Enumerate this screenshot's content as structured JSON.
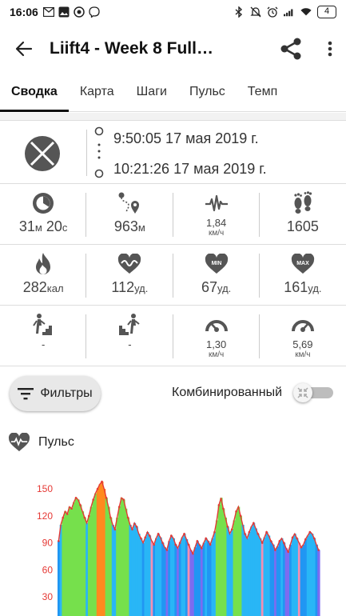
{
  "status_bar": {
    "time": "16:06",
    "battery": "4",
    "left_icons": [
      "mail-icon",
      "photo-icon",
      "camera-icon",
      "viber-icon"
    ],
    "right_icons": [
      "bluetooth-icon",
      "mute-icon",
      "alarm-icon",
      "signal-icon",
      "wifi-icon"
    ]
  },
  "app_bar": {
    "title": "Liift4 - Week 8 Full…",
    "back_icon": "arrow-back-icon",
    "share_icon": "share-icon",
    "more_icon": "more-vert-icon"
  },
  "tabs": [
    {
      "label": "Сводка",
      "active": true
    },
    {
      "label": "Карта",
      "active": false
    },
    {
      "label": "Шаги",
      "active": false
    },
    {
      "label": "Пульс",
      "active": false
    },
    {
      "label": "Темп",
      "active": false
    }
  ],
  "workout": {
    "start_time": "9:50:05 17 мая 2019 г.",
    "end_time": "10:21:26 17 мая 2019 г."
  },
  "stats": [
    [
      {
        "icon": "duration-icon",
        "value": "31",
        "unit1": "м",
        "value2": " 20",
        "unit2": "с"
      },
      {
        "icon": "distance-icon",
        "value": "963",
        "unit1": "м"
      },
      {
        "icon": "speed-icon",
        "value": "1,84",
        "sub": "км/ч",
        "small": true
      },
      {
        "icon": "footprints-icon",
        "value": "1605"
      }
    ],
    [
      {
        "icon": "calories-icon",
        "value": "282",
        "unit1": "кал"
      },
      {
        "icon": "heart-wave-icon",
        "value": "112",
        "unit1": "уд."
      },
      {
        "icon": "heart-min-icon",
        "value": "67",
        "unit1": "уд."
      },
      {
        "icon": "heart-max-icon",
        "value": "161",
        "unit1": "уд."
      }
    ],
    [
      {
        "icon": "stairs-up-icon",
        "value": "-"
      },
      {
        "icon": "stairs-down-icon",
        "value": "-"
      },
      {
        "icon": "gauge-low-icon",
        "value": "1,30",
        "sub": "км/ч",
        "small": true
      },
      {
        "icon": "gauge-high-icon",
        "value": "5,69",
        "sub": "км/ч",
        "small": true
      }
    ]
  ],
  "filters": {
    "button_label": "Фильтры",
    "combined_label": "Комбинированный",
    "combined_on": false
  },
  "section": {
    "title": "Пульс"
  },
  "colors": {
    "axis_label": "#e53935",
    "line": "#e53935",
    "zone_blue": "#2196f3",
    "zone_green": "#76e04c",
    "zone_orange": "#ff8a1f",
    "zone_pink": "#f48fb1",
    "zone_cyan": "#29b6f6",
    "zone_purple": "#7c6cf0"
  },
  "chart_data": {
    "type": "area",
    "title": "",
    "xlabel": "",
    "ylabel": "",
    "y_ticks": [
      30,
      60,
      90,
      120,
      150
    ],
    "ylim": [
      10,
      160
    ],
    "grid": false,
    "series": [
      {
        "values": [
          92,
          110,
          118,
          125,
          122,
          130,
          128,
          135,
          140,
          138,
          132,
          125,
          118,
          112,
          120,
          130,
          138,
          145,
          150,
          155,
          158,
          150,
          140,
          130,
          118,
          110,
          105,
          118,
          130,
          140,
          138,
          128,
          118,
          110,
          105,
          112,
          108,
          100,
          95,
          90,
          96,
          102,
          98,
          92,
          88,
          95,
          100,
          96,
          90,
          85,
          82,
          92,
          98,
          95,
          88,
          84,
          90,
          96,
          100,
          94,
          88,
          82,
          78,
          85,
          92,
          88,
          84,
          90,
          95,
          92,
          88,
          95,
          102,
          115,
          132,
          140,
          128,
          118,
          108,
          100,
          105,
          115,
          125,
          130,
          120,
          110,
          100,
          95,
          102,
          108,
          112,
          106,
          100,
          95,
          90,
          96,
          102,
          98,
          92,
          88,
          82,
          86,
          92,
          95,
          90,
          84,
          80,
          88,
          96,
          100,
          95,
          90,
          85,
          88,
          94,
          98,
          102,
          100,
          95,
          88,
          82
        ]
      }
    ]
  }
}
